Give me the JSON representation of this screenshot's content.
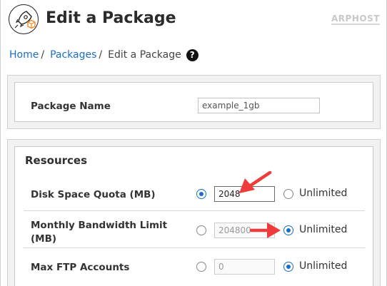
{
  "header": {
    "title": "Edit a Package",
    "brand": "ARPHOST",
    "logo_icon": "rocket-package-icon"
  },
  "breadcrumb": {
    "items": [
      {
        "label": "Home"
      },
      {
        "label": "Packages"
      }
    ],
    "current": "Edit a Package",
    "separator": "/",
    "help_icon": "help-circle-icon",
    "help_glyph": "?"
  },
  "package_name": {
    "label": "Package Name",
    "value": "example_1gb"
  },
  "resources": {
    "title": "Resources",
    "rows": [
      {
        "label": "Disk Space Quota (MB)",
        "value": "2048",
        "unlimited_label": "Unlimited",
        "selected": "value"
      },
      {
        "label_line1": "Monthly Bandwidth Limit",
        "label_line2": "(MB)",
        "value": "204800",
        "unlimited_label": "Unlimited",
        "selected": "unlimited"
      },
      {
        "label": "Max FTP Accounts",
        "value": "0",
        "unlimited_label": "Unlimited",
        "selected": "unlimited"
      }
    ]
  },
  "colors": {
    "accent": "#1a6fc4",
    "annotation_arrow": "#ef3b3b"
  }
}
